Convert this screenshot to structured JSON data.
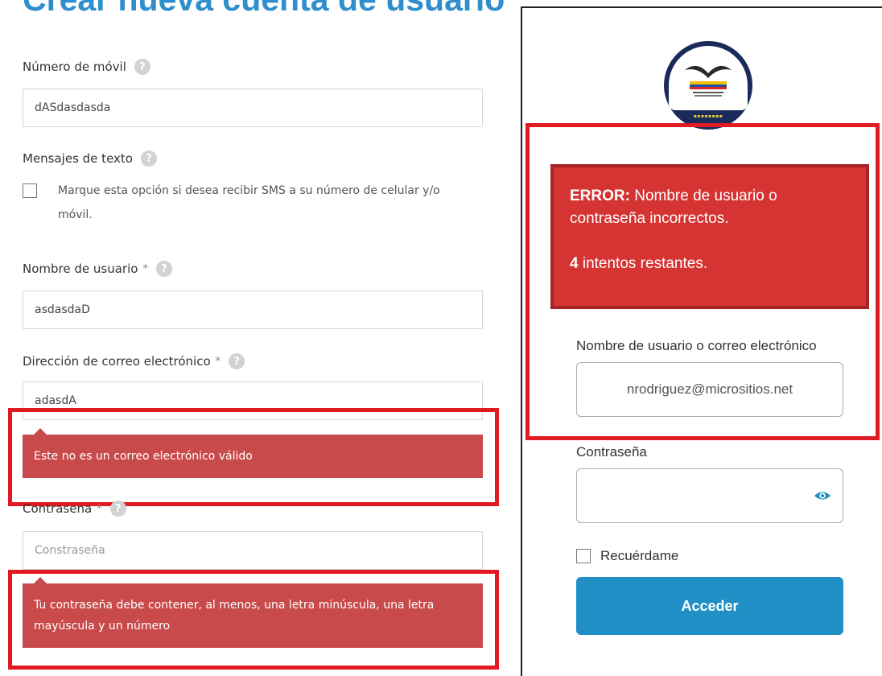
{
  "register": {
    "title": "Crear nueva cuenta de usuario",
    "mobile": {
      "label": "Número de móvil",
      "value": "dASdasdasda"
    },
    "sms": {
      "label": "Mensajes de texto",
      "checkbox_text": "Marque esta opción si desea recibir SMS a su número de celular y/o móvil."
    },
    "username": {
      "label": "Nombre de usuario",
      "required": "*",
      "value": "asdasdaD"
    },
    "email": {
      "label": "Dirección de correo electrónico",
      "required": "*",
      "value": "adasdA",
      "error": "Este no es un correo electrónico válido"
    },
    "password": {
      "label": "Contrasena",
      "required": "*",
      "placeholder": "Constraseña",
      "error": "Tu contraseña debe contener, al menos, una letra minúscula, una letra mayúscula y un número"
    },
    "help_glyph": "?"
  },
  "login": {
    "alert": {
      "error_prefix": "ERROR:",
      "error_message": "Nombre de usuario o contraseña incorrectos.",
      "attempts_count": "4",
      "attempts_text": "intentos restantes."
    },
    "username_label": "Nombre de usuario o correo electrónico",
    "username_value": "nrodriguez@micrositios.net",
    "password_label": "Contraseña",
    "remember_label": "Recuérdame",
    "submit_label": "Acceder"
  },
  "colors": {
    "title_blue": "#2f8fcd",
    "error_bg": "#c94a4a",
    "highlight_red": "#e01b24",
    "alert_red": "#d63333",
    "button_blue": "#1f8fc6"
  }
}
